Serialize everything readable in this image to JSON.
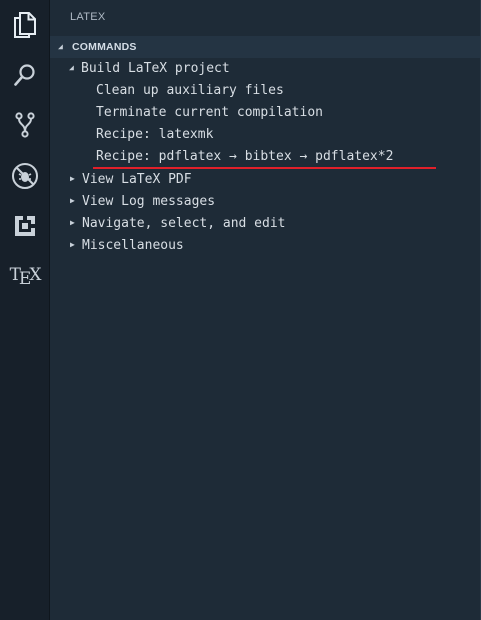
{
  "activity_bar": {
    "items": [
      {
        "icon": "files-icon"
      },
      {
        "icon": "search-icon"
      },
      {
        "icon": "source-control-icon"
      },
      {
        "icon": "debug-icon"
      },
      {
        "icon": "extensions-icon"
      },
      {
        "icon": "tex-icon",
        "label_t": "T",
        "label_e": "E",
        "label_x": "X"
      }
    ]
  },
  "sidebar": {
    "title": "LATEX",
    "section": {
      "label": "COMMANDS",
      "twisty": "◢"
    },
    "tree": [
      {
        "label": "Build LaTeX project",
        "twisty": "◢",
        "expanded": true
      },
      {
        "label": "Clean up auxiliary files"
      },
      {
        "label": "Terminate current compilation"
      },
      {
        "label": "Recipe: latexmk"
      },
      {
        "label": "Recipe: pdflatex → bibtex → pdflatex*2"
      },
      {
        "label": "View LaTeX PDF",
        "twisty": "▶",
        "expanded": false
      },
      {
        "label": "View Log messages",
        "twisty": "▶",
        "expanded": false
      },
      {
        "label": "Navigate, select, and edit",
        "twisty": "▶",
        "expanded": false
      },
      {
        "label": "Miscellaneous",
        "twisty": "▶",
        "expanded": false
      }
    ]
  },
  "colors": {
    "activity_bar_bg": "#17202a",
    "sidebar_bg": "#1e2b37",
    "section_header_bg": "#243443",
    "text": "#d8dee4",
    "annotation_underline": "#e1202a"
  }
}
